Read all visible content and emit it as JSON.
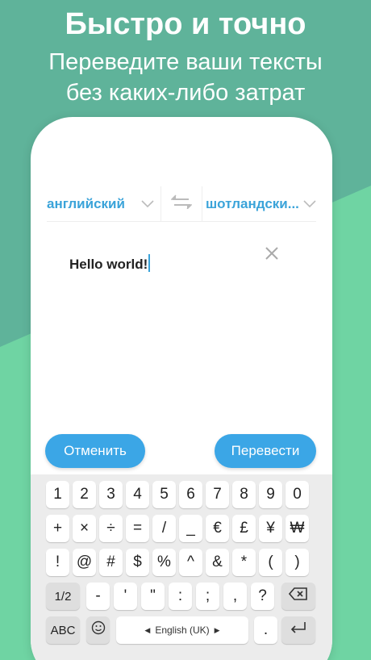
{
  "promo": {
    "title": "Быстро и точно",
    "subtitle_line1": "Переведите ваши тексты",
    "subtitle_line2": "без каких-либо затрат"
  },
  "translator": {
    "source_lang": "английский",
    "target_lang": "шотландски...",
    "input_text": "Hello world!",
    "cancel_label": "Отменить",
    "translate_label": "Перевести"
  },
  "keyboard": {
    "row1": [
      "1",
      "2",
      "3",
      "4",
      "5",
      "6",
      "7",
      "8",
      "9",
      "0"
    ],
    "row2": [
      "+",
      "×",
      "÷",
      "=",
      "/",
      "_",
      "€",
      "£",
      "¥",
      "₩"
    ],
    "row3": [
      "!",
      "@",
      "#",
      "$",
      "%",
      "^",
      "&",
      "*",
      "(",
      ")"
    ],
    "row4": [
      "1/2",
      "-",
      "'",
      "\"",
      ":",
      ";",
      ",",
      "?"
    ],
    "mode_label": "ABC",
    "space_label": "English (UK)",
    "period_label": "."
  },
  "colors": {
    "accent": "#3aa3d9",
    "button": "#3ba6e6",
    "bg_dark": "#5fb39a",
    "bg_light": "#6fd4a3"
  }
}
